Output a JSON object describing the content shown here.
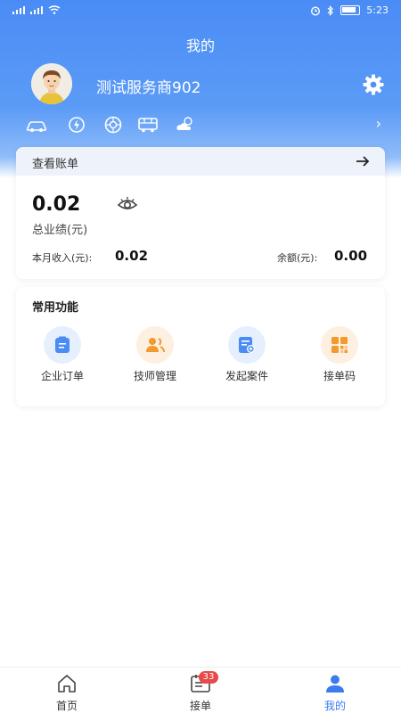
{
  "status_bar": {
    "time": "5:23"
  },
  "header": {
    "title": "我的",
    "username": "测试服务商902"
  },
  "quick_icons": [
    "car-icon",
    "lightning-icon",
    "tire-icon",
    "bus-icon",
    "weather-icon"
  ],
  "bill": {
    "header_label": "查看账单",
    "total_amount": "0.02",
    "total_label": "总业绩(元)",
    "month_income_label": "本月收入(元):",
    "month_income_value": "0.02",
    "balance_label": "余额(元):",
    "balance_value": "0.00"
  },
  "functions": {
    "title": "常用功能",
    "items": [
      {
        "label": "企业订单",
        "icon": "order-icon",
        "color": "#4a8cf5",
        "bg": "#e6effd"
      },
      {
        "label": "技师管理",
        "icon": "technician-icon",
        "color": "#f29a2e",
        "bg": "#fdf0e1"
      },
      {
        "label": "发起案件",
        "icon": "case-icon",
        "color": "#4a8cf5",
        "bg": "#e6effd"
      },
      {
        "label": "接单码",
        "icon": "qrcode-icon",
        "color": "#f29a2e",
        "bg": "#fdf0e1"
      }
    ]
  },
  "tabs": [
    {
      "label": "首页",
      "icon": "home-icon",
      "active": false
    },
    {
      "label": "接单",
      "icon": "calendar-icon",
      "active": false,
      "badge": "33"
    },
    {
      "label": "我的",
      "icon": "user-icon",
      "active": true
    }
  ],
  "colors": {
    "primary": "#4a8cf5",
    "accent_orange": "#f29a2e",
    "badge": "#e84a4a"
  }
}
